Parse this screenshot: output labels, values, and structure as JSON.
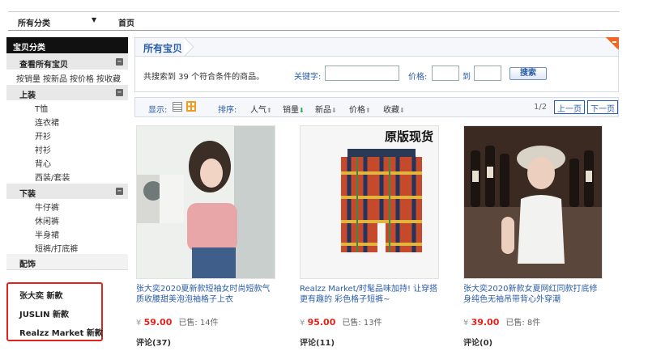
{
  "topnav": {
    "category": "所有分类",
    "home": "首页"
  },
  "sidebar": {
    "header": "宝贝分类",
    "view_all": "查看所有宝贝",
    "sort_links": [
      "按销量",
      "按新品",
      "按价格",
      "按收藏"
    ],
    "sections": [
      {
        "label": "上装",
        "items": [
          "T恤",
          "连衣裙",
          "开衫",
          "衬衫",
          "背心",
          "西装/套装"
        ]
      },
      {
        "label": "下装",
        "items": [
          "牛仔裤",
          "休闲裤",
          "半身裙",
          "短裤/打底裤"
        ]
      }
    ],
    "accessories": "配饰",
    "brands": [
      "张大奕 新款",
      "JUSLIN 新款",
      "Realzz Market 新款"
    ],
    "toggle_icon": "minus-icon"
  },
  "main": {
    "title": "所有宝贝",
    "search": {
      "found_text": "共搜索到 39 个符合条件的商品。",
      "keyword_label": "关键字:",
      "keyword_value": "",
      "price_label": "价格:",
      "price_from": "",
      "to_label": "到",
      "price_to": "",
      "button": "搜索"
    },
    "toolbar": {
      "display_label": "显示:",
      "sort_label": "排序:",
      "sort_options": [
        "人气",
        "销量",
        "新品",
        "价格",
        "收藏"
      ],
      "page_info": "1/2",
      "prev": "上一页",
      "next": "下一页"
    },
    "products": [
      {
        "title": "张大奕2020夏新款短袖女时尚短款气质收腰甜美泡泡袖格子上衣",
        "currency": "¥",
        "price": "59.00",
        "sold": "已售: 14件",
        "comments": "评论(37)",
        "overlay": ""
      },
      {
        "title": "Realzz Market/时髦品味加持! 让穿搭更有趣的 彩色格子短裤~",
        "currency": "¥",
        "price": "95.00",
        "sold": "已售: 13件",
        "comments": "评论(11)",
        "overlay": "原版现货"
      },
      {
        "title": "张大奕2020新款女夏网红同款打底修身纯色无袖吊带背心外穿潮",
        "currency": "¥",
        "price": "39.00",
        "sold": "已售: 8件",
        "comments": "评论(0)",
        "overlay": ""
      }
    ]
  },
  "colors": {
    "link": "#2a5da8",
    "price": "#e2231a",
    "highlight_box": "#e2231a",
    "corner": "#f26522"
  }
}
